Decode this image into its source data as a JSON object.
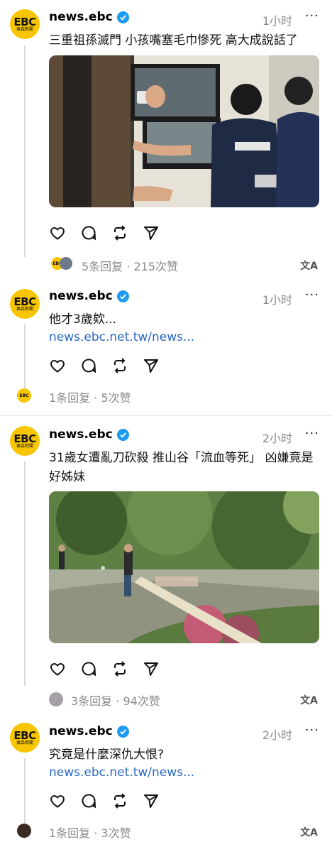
{
  "posts": [
    {
      "avatar_logo": "EBC",
      "avatar_sub": "東森新聞",
      "username": "news.ebc",
      "time": "1小时",
      "more": "···",
      "text": "三重祖孫滅門 小孩嘴塞毛巾慘死 高大成說話了",
      "reply_summary": "5条回复 · 215次赞",
      "translate": "文A"
    },
    {
      "avatar_logo": "EBC",
      "avatar_sub": "東森新聞",
      "username": "news.ebc",
      "time": "1小时",
      "more": "···",
      "text": "他才3歲欸...",
      "link": "news.ebc.net.tw/news...",
      "reply_summary": "1条回复 · 5次赞"
    },
    {
      "avatar_logo": "EBC",
      "avatar_sub": "東森新聞",
      "username": "news.ebc",
      "time": "2小时",
      "more": "···",
      "text": "31歲女遭亂刀砍殺 推山谷「流血等死」 凶嫌竟是好姊妹",
      "reply_summary": "3条回复 · 94次赞",
      "translate": "文A"
    },
    {
      "avatar_logo": "EBC",
      "avatar_sub": "東森新聞",
      "username": "news.ebc",
      "time": "2小时",
      "more": "···",
      "text": "究竟是什麼深仇大恨?",
      "link": "news.ebc.net.tw/news...",
      "reply_summary": "1条回复 · 3次赞",
      "translate": "文A"
    }
  ],
  "colors": {
    "accent": "#f7c600",
    "link": "#2a68c4",
    "verified": "#1d9bf0",
    "muted": "#8a8a8a"
  }
}
